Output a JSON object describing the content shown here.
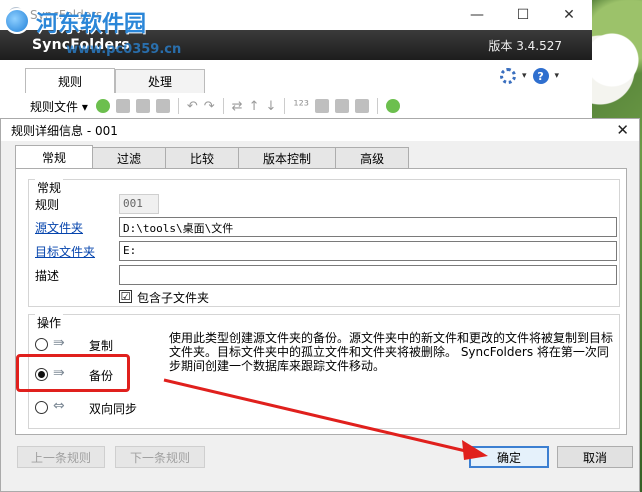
{
  "main_window": {
    "title": "SyncFolders",
    "brand": "SyncFolders",
    "version": "版本 3.4.527",
    "tabs": [
      {
        "label": "规则"
      },
      {
        "label": "处理"
      }
    ],
    "toolbar_menu": "规则文件 ▾",
    "window_controls": {
      "minimize": "—",
      "maximize": "☐",
      "close": "✕"
    }
  },
  "watermark": {
    "title": "河东软件园",
    "url": "www.pc0359.cn"
  },
  "dialog": {
    "title": "规则详细信息 - 001",
    "close": "✕",
    "tabs": [
      {
        "label": "常规"
      },
      {
        "label": "过滤"
      },
      {
        "label": "比较"
      },
      {
        "label": "版本控制"
      },
      {
        "label": "高级"
      }
    ],
    "general": {
      "group_label": "常规",
      "rule_label": "规则",
      "rule_value": "001",
      "source_label": "源文件夹",
      "source_value": "D:\\tools\\桌面\\文件",
      "target_label": "目标文件夹",
      "target_value": "E:",
      "desc_label": "描述",
      "desc_value": "",
      "include_sub_label": "包含子文件夹",
      "include_sub_checked": "☑"
    },
    "operation": {
      "group_label": "操作",
      "options": [
        {
          "label": "复制"
        },
        {
          "label": "备份"
        },
        {
          "label": "双向同步"
        }
      ],
      "selected_index": 1,
      "description": "使用此类型创建源文件夹的备份。源文件夹中的新文件和更改的文件将被复制到目标文件夹。目标文件夹中的孤立文件和文件夹将被删除。 SyncFolders 将在第一次同步期间创建一个数据库来跟踪文件移动。"
    },
    "buttons": {
      "prev": "上一条规则",
      "next": "下一条规则",
      "ok": "确定",
      "cancel": "取消"
    }
  },
  "colors": {
    "highlight": "#e0201d",
    "link": "#0645ad",
    "header_band": "#2a2a2a",
    "default_button": "#3c7fd1"
  }
}
